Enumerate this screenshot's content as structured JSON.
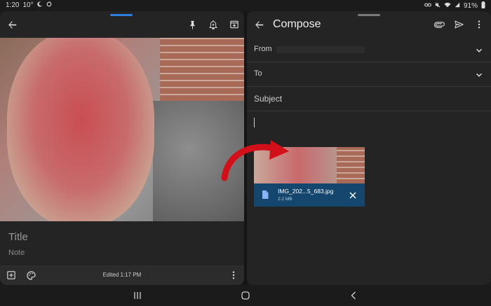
{
  "status_bar": {
    "time": "1:20",
    "temperature": "10°",
    "battery": "91%",
    "icons_left": [
      "moon-icon",
      "sync-icon"
    ],
    "icons_right": [
      "link-icon",
      "mute-icon",
      "wifi-icon",
      "signal-icon",
      "battery-icon"
    ]
  },
  "notes_app": {
    "toolbar_icons": [
      "back-icon",
      "pin-icon",
      "reminder-icon",
      "archive-icon"
    ],
    "title_placeholder": "Title",
    "note_placeholder": "Note",
    "edited_text": "Edited 1:17 PM",
    "bottom_icons": [
      "add-box-icon",
      "palette-icon",
      "more-icon"
    ]
  },
  "compose": {
    "title": "Compose",
    "toolbar_icons": [
      "back-icon",
      "attach-icon",
      "send-icon",
      "more-icon"
    ],
    "from_label": "From",
    "to_label": "To",
    "subject_placeholder": "Subject",
    "attachment": {
      "filename": "IMG_202...5_683.jpg",
      "size": "2.2 MB"
    }
  },
  "colors": {
    "accent_blue": "#2c80e0",
    "attachment_bg": "#14466e",
    "arrow_red": "#d3101a"
  },
  "nav_bar": {
    "icons": [
      "recents-icon",
      "home-icon",
      "back-icon"
    ]
  }
}
